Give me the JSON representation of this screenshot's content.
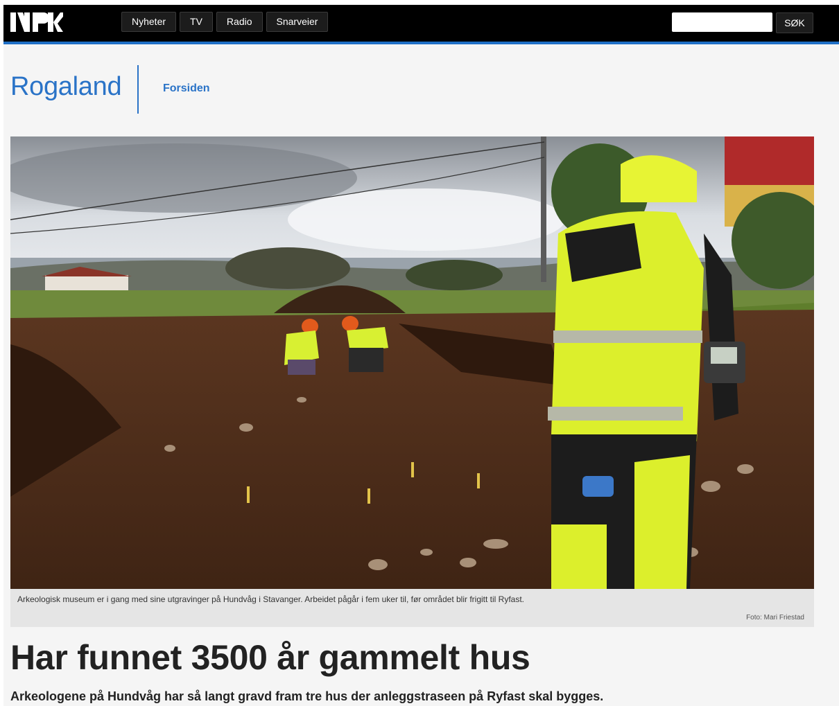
{
  "brand": {
    "logo_text": "NRK"
  },
  "nav": {
    "items": [
      {
        "label": "Nyheter"
      },
      {
        "label": "TV"
      },
      {
        "label": "Radio"
      },
      {
        "label": "Snarveier"
      }
    ]
  },
  "search": {
    "value": "",
    "placeholder": "",
    "button_label": "SØK"
  },
  "region": {
    "title": "Rogaland",
    "link": "Forsiden"
  },
  "article": {
    "image_alt": "Arkeologer graver på Hundvåg",
    "caption": "Arkeologisk museum er i gang med sine utgravinger på Hundvåg i Stavanger. Arbeidet pågår i fem uker til, før området blir frigitt til Ryfast.",
    "credit": "Foto: Mari Friestad",
    "headline": "Har funnet 3500 år gammelt hus",
    "lead": "Arkeologene på Hundvåg har så langt gravd fram tre hus der anleggstraseen på Ryfast skal bygges."
  },
  "colors": {
    "topbar": "#000000",
    "accent": "#2a73c7",
    "nav_button": "#1c1c1c"
  }
}
